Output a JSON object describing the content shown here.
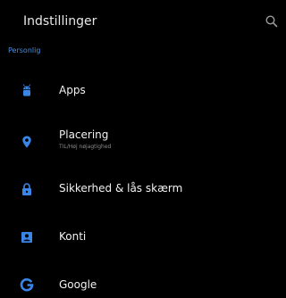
{
  "header": {
    "title": "Indstillinger",
    "search_icon": "search-icon"
  },
  "section": {
    "title": "Personlig"
  },
  "items": [
    {
      "label": "Apps",
      "icon": "android-icon"
    },
    {
      "label": "Placering",
      "subtitle": "TIL/Høj nøjagtighed",
      "icon": "location-pin-icon"
    },
    {
      "label": "Sikkerhed & lås skærm",
      "icon": "lock-icon"
    },
    {
      "label": "Konti",
      "icon": "account-icon"
    },
    {
      "label": "Google",
      "icon": "google-icon"
    }
  ],
  "colors": {
    "background": "#000000",
    "accent": "#4a8fe0",
    "text": "#f2f2f2",
    "secondary_text": "#8a8a8a"
  }
}
